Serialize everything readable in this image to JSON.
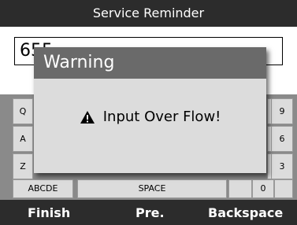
{
  "header": {
    "title": "Service Reminder"
  },
  "input": {
    "value": "655"
  },
  "keyboard": {
    "left_column": [
      "Q",
      "A",
      "Z"
    ],
    "right_column": [
      "9",
      "6",
      "3",
      "0"
    ],
    "bottom_row": {
      "abcde_label": "ABCDE",
      "space_label": "SPACE"
    }
  },
  "footer": {
    "finish": "Finish",
    "prev": "Pre.",
    "backspace": "Backspace"
  },
  "dialog": {
    "title": "Warning",
    "message": "Input Over Flow!",
    "icon": "warning-triangle-icon"
  }
}
